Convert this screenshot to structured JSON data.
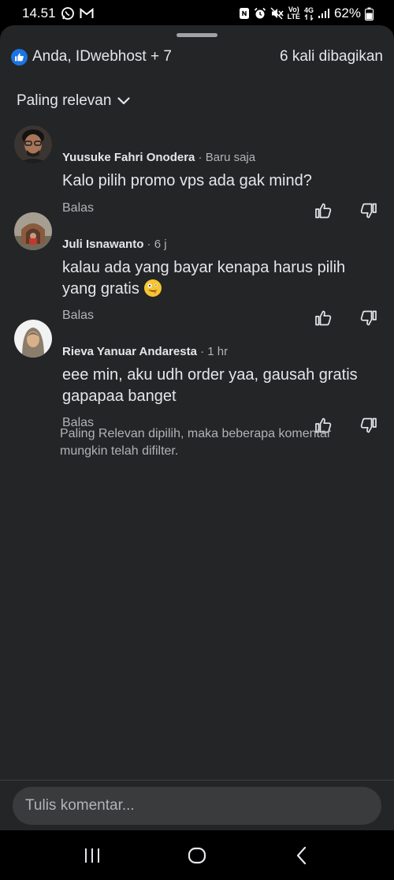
{
  "status_bar": {
    "time": "14.51",
    "battery_text": "62%",
    "network_label": "4G",
    "volte_top": "Vo)",
    "volte_bottom": "LTE",
    "icons": [
      "whatsapp-icon",
      "gmail-icon",
      "nfc-icon",
      "alarm-icon",
      "mute-icon",
      "volte-icon",
      "4g-icon",
      "signal-icon",
      "battery-icon"
    ]
  },
  "header": {
    "reactions_text": "Anda, IDwebhost + 7",
    "shares_text": "6 kali dibagikan",
    "like_color": "#1b74e4"
  },
  "sort": {
    "label": "Paling relevan"
  },
  "comments": [
    {
      "name": "Yuusuke Fahri Onodera",
      "time": " · Baru saja",
      "text": "Kalo pilih promo vps ada gak mind?",
      "reply_label": "Balas"
    },
    {
      "name": "Juli Isnawanto",
      "time": " · 6 j",
      "text": "kalau ada yang bayar kenapa harus pilih yang gratis",
      "reply_label": "Balas"
    },
    {
      "name": "Rieva Yanuar Andaresta",
      "time": " · 1 hr",
      "text": "eee min, aku udh order yaa, gausah gratis gapapaa banget",
      "reply_label": "Balas"
    }
  ],
  "filter_note": "Paling Relevan dipilih, maka beberapa komentar mungkin telah difilter.",
  "composer": {
    "placeholder": "Tulis komentar..."
  },
  "colors": {
    "sheet_bg": "#242526",
    "text_primary": "#e4e6eb",
    "text_secondary": "#b0b3b8",
    "input_bg": "#3a3b3c"
  }
}
